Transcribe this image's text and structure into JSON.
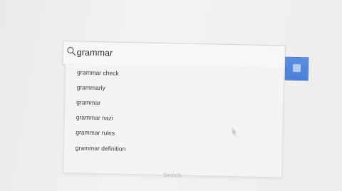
{
  "search": {
    "query": "grammar",
    "suggestions": [
      "grammar check",
      "grammarly",
      "grammar",
      "grammar nazi",
      "grammar rules",
      "grammar definition"
    ],
    "footer_label": "Search"
  },
  "icons": {
    "search": "search-icon",
    "submit": "search-button-icon",
    "cursor": "mouse-cursor-icon"
  },
  "colors": {
    "accent": "#4a7fd8",
    "text": "#3c3c3c"
  }
}
